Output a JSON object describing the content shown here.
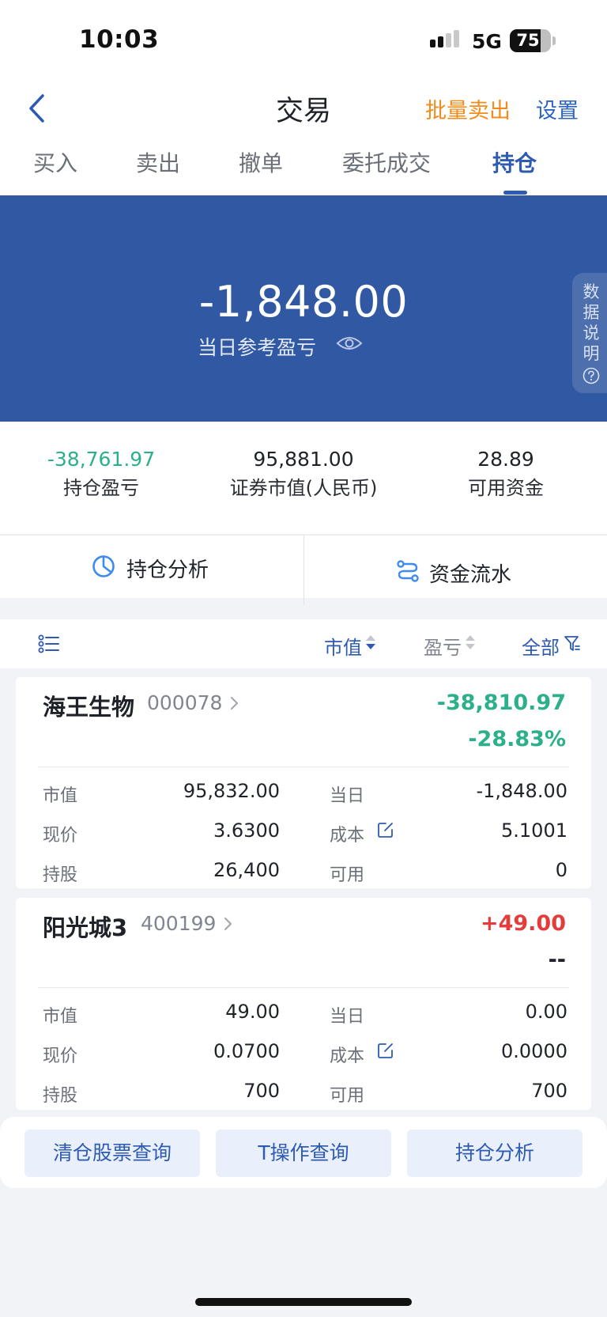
{
  "status_bar": {
    "time": "10:03",
    "network": "5G",
    "battery": "75",
    "battery_level": 0.75
  },
  "header": {
    "title": "交易",
    "batch_sell": "批量卖出",
    "settings": "设置"
  },
  "tabs": [
    {
      "label": "买入",
      "active": false
    },
    {
      "label": "卖出",
      "active": false
    },
    {
      "label": "撤单",
      "active": false
    },
    {
      "label": "委托成交",
      "active": false
    },
    {
      "label": "持仓",
      "active": true
    }
  ],
  "hero": {
    "value": "-1,848.00",
    "label": "当日参考盈亏",
    "side_tab": "数据说明"
  },
  "summary": [
    {
      "value": "-38,761.97",
      "label": "持仓盈亏",
      "tone": "green"
    },
    {
      "value": "95,881.00",
      "label": "证券市值(人民币)",
      "tone": "dark"
    },
    {
      "value": "28.89",
      "label": "可用资金",
      "tone": "dark"
    }
  ],
  "actions": {
    "analysis": "持仓分析",
    "cash_flow": "资金流水"
  },
  "list_header": {
    "market_value": "市值",
    "pnl": "盈亏",
    "filter": "全部"
  },
  "holdings": [
    {
      "name": "海王生物",
      "code": "000078",
      "pnl": "-38,810.97",
      "pnl_pct": "-28.83%",
      "pnl_tone": "green",
      "pct_tone": "green",
      "fields": {
        "market_value_label": "市值",
        "market_value": "95,832.00",
        "today_label": "当日",
        "today": "-1,848.00",
        "today_tone": "green",
        "price_label": "现价",
        "price": "3.6300",
        "cost_label": "成本",
        "cost": "5.1001",
        "shares_label": "持股",
        "shares": "26,400",
        "available_label": "可用",
        "available": "0"
      }
    },
    {
      "name": "阳光城3",
      "code": "400199",
      "pnl": "+49.00",
      "pnl_pct": "--",
      "pnl_tone": "red",
      "pct_tone": "dark",
      "fields": {
        "market_value_label": "市值",
        "market_value": "49.00",
        "today_label": "当日",
        "today": "0.00",
        "today_tone": "dark",
        "price_label": "现价",
        "price": "0.0700",
        "cost_label": "成本",
        "cost": "0.0000",
        "shares_label": "持股",
        "shares": "700",
        "available_label": "可用",
        "available": "700"
      }
    }
  ],
  "bottom_buttons": [
    "清仓股票查询",
    "T操作查询",
    "持仓分析"
  ],
  "colors": {
    "primary_blue": "#3159a3",
    "accent_orange": "#f28b1a",
    "gain_red": "#e53b3b",
    "loss_green": "#2cb08c"
  }
}
